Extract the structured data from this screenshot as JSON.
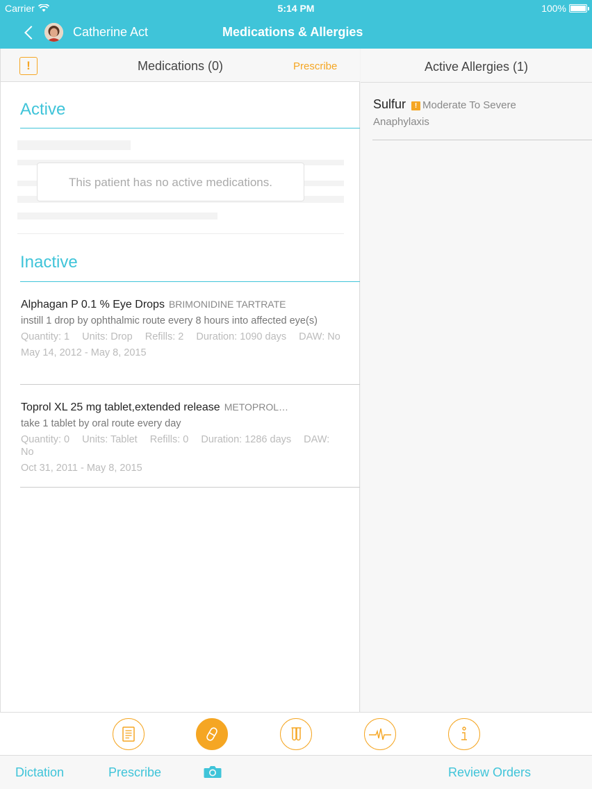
{
  "status_bar": {
    "carrier": "Carrier",
    "time": "5:14 PM",
    "battery": "100%"
  },
  "header": {
    "patient_name": "Catherine Act",
    "title": "Medications & Allergies"
  },
  "medications": {
    "alert_icon": "!",
    "title": "Medications (0)",
    "prescribe_label": "Prescribe",
    "active_title": "Active",
    "empty_message": "This patient has no active medications.",
    "inactive_title": "Inactive",
    "inactive": [
      {
        "name": "Alphagan P 0.1 % Eye Drops",
        "generic": "BRIMONIDINE TARTRATE",
        "sig": "instill 1 drop by ophthalmic route  every 8 hours into affected eye(s)",
        "quantity": "Quantity: 1",
        "units": "Units: Drop",
        "refills": "Refills: 2",
        "duration": "Duration: 1090 days",
        "daw": "DAW: No",
        "dates": "May 14, 2012 - May 8, 2015"
      },
      {
        "name": "Toprol XL 25 mg tablet,extended release",
        "generic": "METOPROL…",
        "sig": "take 1 tablet by oral route  every day",
        "quantity": "Quantity: 0",
        "units": "Units: Tablet",
        "refills": "Refills: 0",
        "duration": "Duration: 1286 days",
        "daw": "DAW: No",
        "dates": "Oct 31, 2011 - May 8, 2015"
      }
    ]
  },
  "allergies": {
    "title": "Active Allergies (1)",
    "items": [
      {
        "name": "Sulfur",
        "severity_icon": "!",
        "severity": "Moderate To Severe",
        "reaction": "Anaphylaxis"
      }
    ]
  },
  "toolbar": {
    "icons": [
      "document-icon",
      "pill-icon",
      "test-tubes-icon",
      "heartbeat-icon",
      "info-icon"
    ],
    "active_index": 1,
    "accent_color": "#f5a623"
  },
  "tabbar": {
    "dictation": "Dictation",
    "prescribe": "Prescribe",
    "camera_icon": "camera-icon",
    "review_orders": "Review Orders"
  },
  "colors": {
    "header": "#3fc4d9",
    "accent": "#f5a623"
  }
}
